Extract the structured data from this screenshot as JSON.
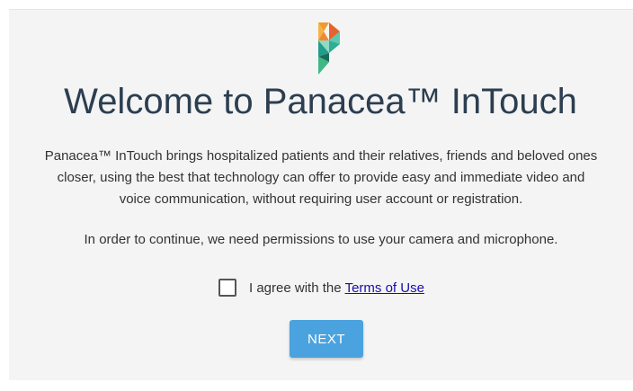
{
  "welcome": {
    "title": "Welcome to Panacea™ InTouch",
    "description_lines": [
      "Panacea™ InTouch brings hospitalized patients and their relatives, friends and beloved ones",
      "closer, using the best that technology can offer to provide easy and immediate video and",
      "voice communication, without requiring user account or registration."
    ],
    "permissions_text": "In order to continue, we need permissions to use your camera and microphone.",
    "agree_text": "I agree with the",
    "terms_link": "Terms of Use",
    "agree_checked": false,
    "next_label": "NEXT"
  },
  "colors": {
    "title": "#2c3e50",
    "button": "#4aa3df",
    "link": "#1a0dab",
    "logo_orange": "#f29a2e",
    "logo_red_orange": "#e8622c",
    "logo_light_teal": "#5cc8b0",
    "logo_teal": "#1f9e89",
    "logo_dark_teal": "#1a6b5c",
    "logo_green": "#3fb884"
  },
  "icons": {
    "logo": "panacea-logo-icon",
    "checkbox": "checkbox-icon"
  }
}
